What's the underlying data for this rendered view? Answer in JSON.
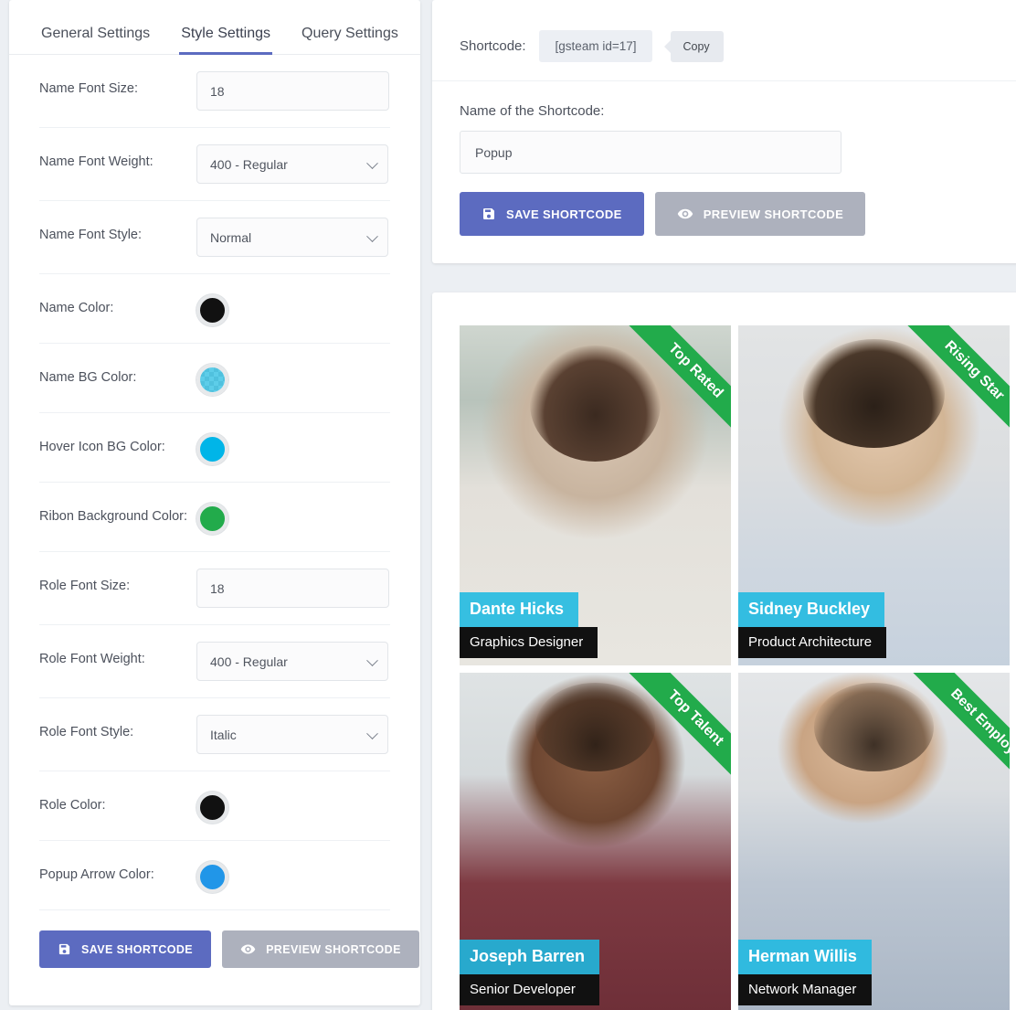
{
  "settings": {
    "tabs": [
      {
        "label": "General Settings",
        "active": false
      },
      {
        "label": "Style Settings",
        "active": true
      },
      {
        "label": "Query Settings",
        "active": false
      }
    ],
    "rows": [
      {
        "label": "Name Font Size:",
        "type": "text",
        "value": "18"
      },
      {
        "label": "Name Font Weight:",
        "type": "select",
        "value": "400 - Regular"
      },
      {
        "label": "Name Font Style:",
        "type": "select",
        "value": "Normal"
      },
      {
        "label": "Name Color:",
        "type": "color",
        "value": "#111111",
        "transparent": false
      },
      {
        "label": "Name BG Color:",
        "type": "color",
        "value": "#1ebae1",
        "transparent": true
      },
      {
        "label": "Hover Icon BG Color:",
        "type": "color",
        "value": "#00b5e8",
        "transparent": false
      },
      {
        "label": "Ribon Background Color:",
        "type": "color",
        "value": "#22ab4b",
        "transparent": false
      },
      {
        "label": "Role Font Size:",
        "type": "text",
        "value": "18"
      },
      {
        "label": "Role Font Weight:",
        "type": "select",
        "value": "400 - Regular"
      },
      {
        "label": "Role Font Style:",
        "type": "select",
        "value": "Italic"
      },
      {
        "label": "Role Color:",
        "type": "color",
        "value": "#111111",
        "transparent": false
      },
      {
        "label": "Popup Arrow Color:",
        "type": "color",
        "value": "#2196e8",
        "transparent": false
      }
    ],
    "save_label": "SAVE SHORTCODE",
    "preview_label": "PREVIEW SHORTCODE"
  },
  "shortcode": {
    "label": "Shortcode:",
    "code": "[gsteam id=17]",
    "copy_label": "Copy",
    "name_label": "Name of the Shortcode:",
    "name_value": "Popup",
    "name_placeholder": "Name of the Shortcode",
    "save_label": "SAVE SHORTCODE",
    "preview_label": "PREVIEW SHORTCODE"
  },
  "team": {
    "members": [
      {
        "name": "Dante Hicks",
        "role": "Graphics Designer",
        "ribbon": "Top Rated",
        "photo_class": "ph1",
        "ribbon_wide": false
      },
      {
        "name": "Sidney Buckley",
        "role": "Product Architecture",
        "ribbon": "Rising Star",
        "photo_class": "ph2",
        "ribbon_wide": false
      },
      {
        "name": "Joseph Barren",
        "role": "Senior Developer",
        "ribbon": "Top Talent",
        "photo_class": "ph3",
        "ribbon_wide": false
      },
      {
        "name": "Herman Willis",
        "role": "Network Manager",
        "ribbon": "Best Employee",
        "photo_class": "ph4",
        "ribbon_wide": true
      }
    ]
  },
  "colors": {
    "accent_purple": "#5c6bc0",
    "accent_cyan": "#1ebae1",
    "ribbon_green": "#22ab4b",
    "button_gray": "#adb1bd",
    "page_bg": "#eceff3"
  }
}
